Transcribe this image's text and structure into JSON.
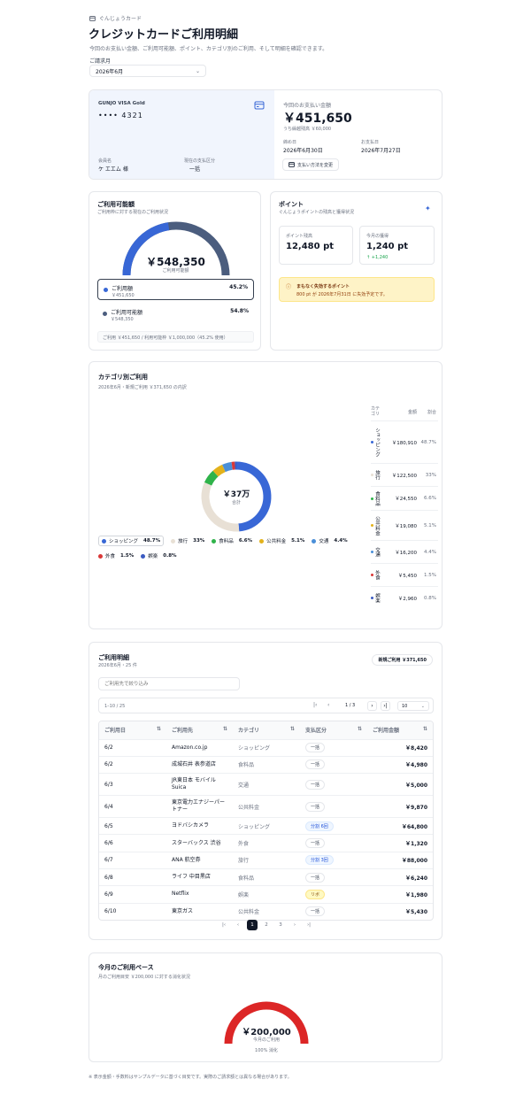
{
  "brand": {
    "name": "ぐんじょうカード",
    "icon": "credit-card-icon"
  },
  "page": {
    "title": "クレジットカードご利用明細",
    "subtitle": "今回のお支払い金額、ご利用可能額、ポイント、カテゴリ別のご利用、そして明細を確認できます。"
  },
  "billing": {
    "label": "ご請求月",
    "selected": "2026年6月"
  },
  "card": {
    "name": "GUNJO VISA Gold",
    "number": "•••• 4321",
    "holder_label": "会員名",
    "holder": "ケ エエム 様",
    "method_label": "現在の支払区分",
    "method": "一括"
  },
  "payment": {
    "label": "今回のお支払い金額",
    "amount": "￥451,650",
    "note": "うち繰越残高 ￥60,000",
    "close_label": "締め日",
    "close_date": "2026年6月30日",
    "due_label": "お支払日",
    "due_date": "2026年7月27日",
    "change_button": "支払い方法を変更"
  },
  "availability": {
    "title": "ご利用可能額",
    "subtitle": "ご利用枠に対する現在のご利用状況",
    "center_value": "￥548,350",
    "center_label": "ご利用可能額",
    "used_fraction": 0.452,
    "items": [
      {
        "label": "ご利用額",
        "amount": "￥451,650",
        "pct": "45.2%",
        "color": "#3867d6"
      },
      {
        "label": "ご利用可能額",
        "amount": "￥548,350",
        "pct": "54.8%",
        "color": "#4b5d7e"
      }
    ],
    "footer": "ご利用 ￥451,650 / 利用可能枠 ￥1,000,000（45.2% 使用）"
  },
  "points": {
    "title": "ポイント",
    "subtitle": "ぐんじょうポイントの残高と獲得状況",
    "balance_label": "ポイント残高",
    "balance": "12,480 pt",
    "earned_label": "今月の獲得",
    "earned": "1,240 pt",
    "delta": "↑ +1,240",
    "alert_title": "まもなく失効するポイント",
    "alert_text": "800 pt が 2026年7月31日 に失効予定です。"
  },
  "category": {
    "title": "カテゴリ別ご利用",
    "subtitle": "2026年6月・新規ご利用 ￥371,650 の内訳",
    "center_value": "￥37万",
    "center_label": "合計",
    "col_category": "カテゴリ",
    "col_amount": "金額",
    "col_share": "割合",
    "items": [
      {
        "name": "ショッピング",
        "pct": "48.7%",
        "amount": "￥180,910",
        "share": 0.487,
        "color": "#3867d6"
      },
      {
        "name": "旅行",
        "pct": "33%",
        "amount": "￥122,500",
        "share": 0.33,
        "color": "#e8e0d5"
      },
      {
        "name": "食料品",
        "pct": "6.6%",
        "amount": "￥24,550",
        "share": 0.066,
        "color": "#2fb34a"
      },
      {
        "name": "公共料金",
        "pct": "5.1%",
        "amount": "￥19,080",
        "share": 0.051,
        "color": "#e3b21b"
      },
      {
        "name": "交通",
        "pct": "4.4%",
        "amount": "￥16,200",
        "share": 0.044,
        "color": "#4a8fd8"
      },
      {
        "name": "外食",
        "pct": "1.5%",
        "amount": "￥5,450",
        "share": 0.015,
        "color": "#d93838"
      },
      {
        "name": "娯楽",
        "pct": "0.8%",
        "amount": "￥2,960",
        "share": 0.008,
        "color": "#3b5bc2"
      }
    ]
  },
  "statement": {
    "title": "ご利用明細",
    "subtitle": "2026年6月・25 件",
    "badge": "新規ご利用 ￥371,650",
    "search_placeholder": "ご利用先で絞り込み",
    "range": "1–10 / 25",
    "page_info": "1 / 3",
    "per_page": "10",
    "columns": [
      "ご利用日",
      "ご利用先",
      "カテゴリ",
      "支払区分",
      "ご利用金額"
    ],
    "rows": [
      {
        "date": "6/2",
        "merchant": "Amazon.co.jp",
        "category": "ショッピング",
        "method": "一括",
        "kind": "",
        "amount": "￥8,420"
      },
      {
        "date": "6/2",
        "merchant": "成城石井 表参道店",
        "category": "食料品",
        "method": "一括",
        "kind": "",
        "amount": "￥4,980"
      },
      {
        "date": "6/3",
        "merchant": "JR東日本 モバイルSuica",
        "category": "交通",
        "method": "一括",
        "kind": "",
        "amount": "￥5,000"
      },
      {
        "date": "6/4",
        "merchant": "東京電力エナジーパートナー",
        "category": "公共料金",
        "method": "一括",
        "kind": "",
        "amount": "￥9,870"
      },
      {
        "date": "6/5",
        "merchant": "ヨドバシカメラ",
        "category": "ショッピング",
        "method": "分割 6回",
        "kind": "blue",
        "amount": "￥64,800"
      },
      {
        "date": "6/6",
        "merchant": "スターバックス 渋谷",
        "category": "外食",
        "method": "一括",
        "kind": "",
        "amount": "￥1,320"
      },
      {
        "date": "6/7",
        "merchant": "ANA 航空券",
        "category": "旅行",
        "method": "分割 3回",
        "kind": "blue",
        "amount": "￥88,000"
      },
      {
        "date": "6/8",
        "merchant": "ライフ 中目黒店",
        "category": "食料品",
        "method": "一括",
        "kind": "",
        "amount": "￥6,240"
      },
      {
        "date": "6/9",
        "merchant": "Netflix",
        "category": "娯楽",
        "method": "リボ",
        "kind": "yellow",
        "amount": "￥1,980"
      },
      {
        "date": "6/10",
        "merchant": "東京ガス",
        "category": "公共料金",
        "method": "一括",
        "kind": "",
        "amount": "￥5,430"
      }
    ],
    "pages": [
      "1",
      "2",
      "3"
    ]
  },
  "pace": {
    "title": "今月のご利用ペース",
    "subtitle": "月のご利用目安 ￥200,000 に対する消化状況",
    "center_value": "￥200,000",
    "center_label": "今月のご利用",
    "consumed": "100% 消化",
    "fraction": 1.0,
    "color": "#dc2626"
  },
  "footnote": "※ 表示金額・手数料はサンプルデータに基づく目安です。実際のご請求額とは異なる場合があります。"
}
